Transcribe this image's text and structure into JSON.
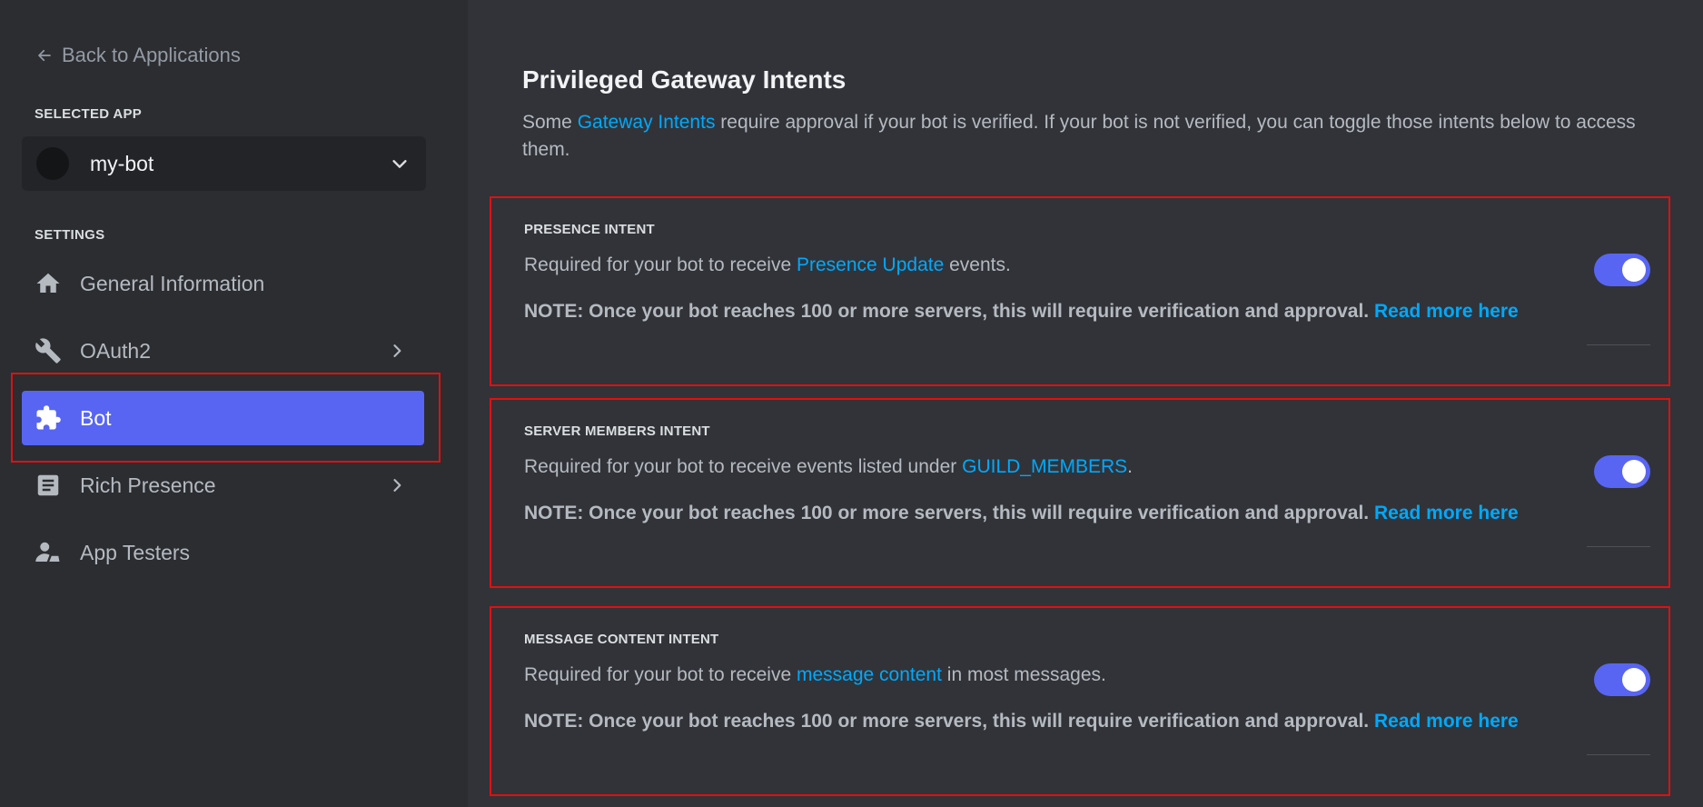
{
  "sidebar": {
    "back_label": "Back to Applications",
    "selected_app_label": "SELECTED APP",
    "app_name": "my-bot",
    "settings_label": "SETTINGS",
    "items": [
      {
        "label": "General Information"
      },
      {
        "label": "OAuth2"
      },
      {
        "label": "Bot"
      },
      {
        "label": "Rich Presence"
      },
      {
        "label": "App Testers"
      }
    ],
    "active_item": "Bot"
  },
  "main": {
    "title": "Privileged Gateway Intents",
    "desc_before": "Some ",
    "desc_link": "Gateway Intents",
    "desc_after": " require approval if your bot is verified. If your bot is not verified, you can toggle those intents below to access them.",
    "intents": [
      {
        "title": "PRESENCE INTENT",
        "desc_before": "Required for your bot to receive ",
        "desc_link": "Presence Update",
        "desc_after": " events.",
        "note": "NOTE: Once your bot reaches 100 or more servers, this will require verification and approval.",
        "note_link": "Read more here",
        "enabled": true
      },
      {
        "title": "SERVER MEMBERS INTENT",
        "desc_before": "Required for your bot to receive events listed under ",
        "desc_link": "GUILD_MEMBERS",
        "desc_after": ".",
        "note": "NOTE: Once your bot reaches 100 or more servers, this will require verification and approval.",
        "note_link": "Read more here",
        "enabled": true
      },
      {
        "title": "MESSAGE CONTENT INTENT",
        "desc_before": "Required for your bot to receive ",
        "desc_link": "message content",
        "desc_after": " in most messages.",
        "note": "NOTE: Once your bot reaches 100 or more servers, this will require verification and approval.",
        "note_link": "Read more here",
        "enabled": true
      }
    ]
  },
  "colors": {
    "accent": "#5865f2",
    "link": "#00a8fc",
    "highlight": "#e01010"
  }
}
